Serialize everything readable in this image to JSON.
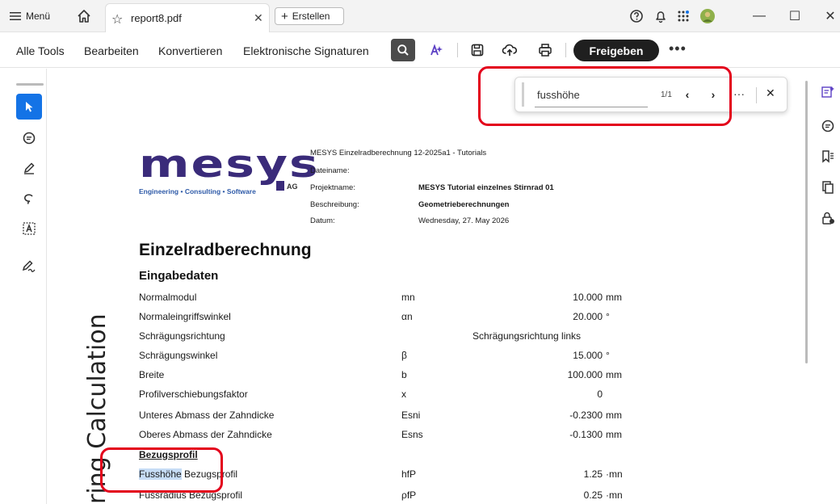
{
  "titlebar": {
    "menu_label": "Menü",
    "tab_name": "report8.pdf",
    "create_label": "Erstellen"
  },
  "toolbar": {
    "items": [
      "Alle Tools",
      "Bearbeiten",
      "Konvertieren",
      "Elektronische Signaturen"
    ],
    "share_label": "Freigeben",
    "more_label": "•••"
  },
  "find": {
    "query": "fusshöhe",
    "count": "1/1",
    "more_label": "···"
  },
  "document": {
    "logo_text": "mesys",
    "logo_tagline": "Engineering • Consulting • Software",
    "logo_ag": "AG",
    "header_line": "MESYS Einzelradberechnung 12-2025a1 - Tutorials",
    "meta": [
      {
        "label": "Dateiname:",
        "value": ""
      },
      {
        "label": "Projektname:",
        "value": "MESYS Tutorial einzelnes Stirnrad 01"
      },
      {
        "label": "Beschreibung:",
        "value": "Geometrieberechnungen"
      },
      {
        "label": "Datum:",
        "value": "Wednesday, 27. May 2026"
      }
    ],
    "title": "Einzelradberechnung",
    "section": "Eingabedaten",
    "rows": [
      {
        "name": "Normalmodul",
        "symbol": "mn",
        "value": "10.000",
        "unit": "mm"
      },
      {
        "name": "Normaleingriffswinkel",
        "symbol": "αn",
        "value": "20.000",
        "unit": "°"
      },
      {
        "name": "Schrägungsrichtung",
        "wide": "Schrägungsrichtung links"
      },
      {
        "name": "Schrägungswinkel",
        "symbol": "β",
        "value": "15.000",
        "unit": "°"
      },
      {
        "name": "Breite",
        "symbol": "b",
        "value": "100.000",
        "unit": "mm"
      },
      {
        "name": "Profilverschiebungsfaktor",
        "symbol": "x",
        "value": "0",
        "unit": ""
      },
      {
        "name": "Unteres Abmass der Zahndicke",
        "symbol": "Esni",
        "value": "-0.2300",
        "unit": "mm"
      },
      {
        "name": "Oberes Abmass der Zahndicke",
        "symbol": "Esns",
        "value": "-0.1300",
        "unit": "mm"
      }
    ],
    "subsection": "Bezugsprofil",
    "ref_rows": [
      {
        "name_hl": "Fusshöhe",
        "name_rest": " Bezugsprofil",
        "symbol": "hfP",
        "value": "1.25",
        "unit": "·mn"
      },
      {
        "name": "Fussradius Bezugsprofil",
        "symbol": "ρfP",
        "value": "0.25",
        "unit": "·mn"
      }
    ],
    "vertical_text": "ring Calculation"
  }
}
